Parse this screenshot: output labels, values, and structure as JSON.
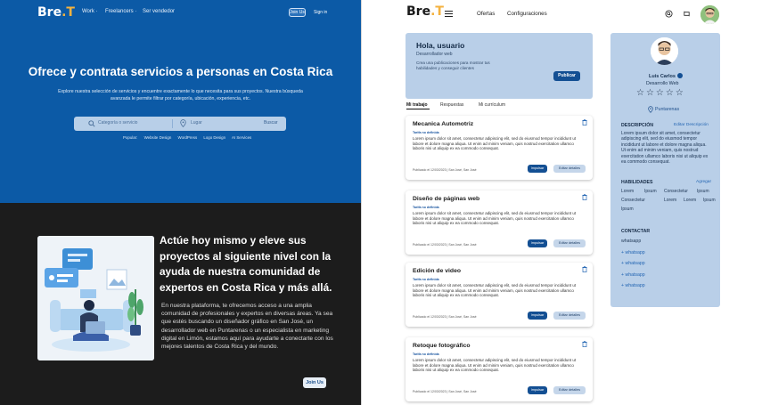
{
  "brand": {
    "logo_main": "Bre",
    "logo_accent": ".T",
    "accent_color": "#f4b23f",
    "primary_color": "#0c5aa6",
    "dark_bg": "#1c1c1c"
  },
  "left": {
    "nav": {
      "work": "Work ·",
      "freelancers": "Freelancers ·",
      "seller": "Ser vendedor",
      "join": "Join Us",
      "signin": "Sign in"
    },
    "hero": {
      "title": "Ofrece y contrata servicios a personas en Costa Rica",
      "description": "Explore nuestra selección de servicios y encuentre exactamente lo que necesita para sus proyectos. Nuestra búsqueda avanzada le permite filtrar por categoría, ubicación, experiencia, etc.",
      "search_placeholder": "Categoría o servicio",
      "location_placeholder": "Lugar",
      "search_button": "Buscar",
      "popular": [
        "Popular:",
        "Website Design",
        "WordPress",
        "Logo Design",
        "AI Services"
      ]
    },
    "cta": {
      "title": "Actúe hoy mismo y eleve sus proyectos al siguiente nivel con la ayuda de nuestra comunidad de expertos en Costa Rica y más allá.",
      "body": "En nuestra plataforma, te ofrecemos acceso a una amplia comunidad de profesionales y expertos en diversas áreas. Ya sea que estés buscando un diseñador gráfico en San José, un desarrollador web en Puntarenas o un especialista en marketing digital en Limón, estamos aquí para ayudarte a conectarte con los mejores talentos de Costa Rica y del mundo.",
      "join_button": "Join Us"
    }
  },
  "right": {
    "nav": {
      "offers": "Ofertas",
      "config": "Configuraciones"
    },
    "welcome": {
      "title": "Hola, usuario",
      "subtitle": "Desarrollador web",
      "text": "Crea una publicaciones para mostrar tus habilidades y conseguir clientes",
      "button": "Publicar"
    },
    "tabs": [
      "Mi trabajo",
      "Respuestas",
      "Mi currículum"
    ],
    "cards": [
      {
        "title": "Mecanica Automotriz",
        "tag": "Tarifa no definida",
        "text": "Lorem ipsum dolor sit amet, consectetur adipiscing elit, sed do eiusmod tempor incididunt ut labore et dolore magna aliqua. Ut enim ad minim veniam, quis nostrud exercitation ullamco laboris nisi ut aliquip ex ea commodo consequat.",
        "meta": "Publicado el 12/03/2023 | San José, San José",
        "btn_primary": "Impulsar",
        "btn_secondary": "Editar detalles"
      },
      {
        "title": "Diseño de páginas web",
        "tag": "Tarifa no definida",
        "text": "Lorem ipsum dolor sit amet, consectetur adipiscing elit, sed do eiusmod tempor incididunt ut labore et dolore magna aliqua. Ut enim ad minim veniam, quis nostrud exercitation ullamco laboris nisi ut aliquip ex ea commodo consequat.",
        "meta": "Publicado el 12/03/2023 | San José, San José",
        "btn_primary": "Impulsar",
        "btn_secondary": "Editar detalles"
      },
      {
        "title": "Edición de video",
        "tag": "Tarifa no definida",
        "text": "Lorem ipsum dolor sit amet, consectetur adipiscing elit, sed do eiusmod tempor incididunt ut labore et dolore magna aliqua. Ut enim ad minim veniam, quis nostrud exercitation ullamco laboris nisi ut aliquip ex ea commodo consequat.",
        "meta": "Publicado el 12/03/2023 | San José, San José",
        "btn_primary": "Impulsar",
        "btn_secondary": "Editar detalles"
      },
      {
        "title": "Retoque fotográfico",
        "tag": "Tarifa no definida",
        "text": "Lorem ipsum dolor sit amet, consectetur adipiscing elit, sed do eiusmod tempor incididunt ut labore et dolore magna aliqua. Ut enim ad minim veniam, quis nostrud exercitation ullamco laboris nisi ut aliquip ex ea commodo consequat.",
        "meta": "Publicado el 12/03/2023 | San José, San José",
        "btn_primary": "Impulsar",
        "btn_secondary": "Editar detalles"
      }
    ],
    "profile": {
      "name": "Luis Carlos",
      "role": "Desarrollo Web",
      "rating_stars": "☆☆☆☆☆",
      "location": "Puntarenas",
      "description_head": "DESCRIPCIÓN",
      "description_edit": "Editar Descripción",
      "description": "Lorem ipsum dolor sit amet, consectetur adipiscing elit, sed do eiusmod tempor incididunt ut labore et dolore magna aliqua. Ut enim ad minim veniam, quis nostrud exercitation ullamco laboris nisi ut aliquip ex ea commodo consequat.",
      "skills_head": "HABILIDADES",
      "skills_add": "Agregar",
      "skills": [
        "Lorem",
        "Ipsum",
        "Consectetur",
        "Ipsum",
        "Consectetur",
        "Lorem",
        "Lorem",
        "Ipsum",
        "Ipsum"
      ],
      "contact_head": "CONTACTAR",
      "contacts": [
        "whatsapp",
        "+ whatsapp",
        "+ whatsapp",
        "+ whatsapp",
        "+ whatsapp"
      ]
    }
  }
}
